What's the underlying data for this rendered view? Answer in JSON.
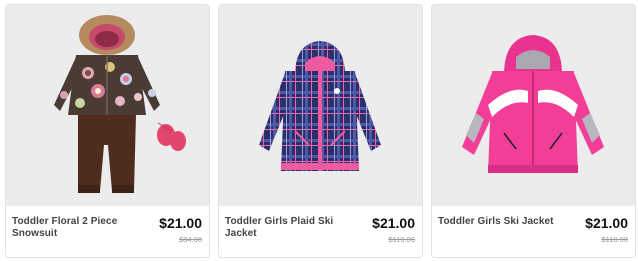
{
  "products": [
    {
      "name": "Toddler Floral 2 Piece Snowsuit",
      "price": "$21.00",
      "original_price": "$84.00",
      "image_label": "snowsuit-photo"
    },
    {
      "name": "Toddler Girls Plaid Ski Jacket",
      "price": "$21.00",
      "original_price": "$110.00",
      "image_label": "plaid-jacket-photo"
    },
    {
      "name": "Toddler Girls Ski Jacket",
      "price": "$21.00",
      "original_price": "$110.00",
      "image_label": "pink-jacket-photo"
    }
  ],
  "colors": {
    "photo_background": "#ececec",
    "price_text": "#111111",
    "name_text": "#444444",
    "strike_price": "#9a9a9a",
    "card_border": "#e2e2e2"
  }
}
